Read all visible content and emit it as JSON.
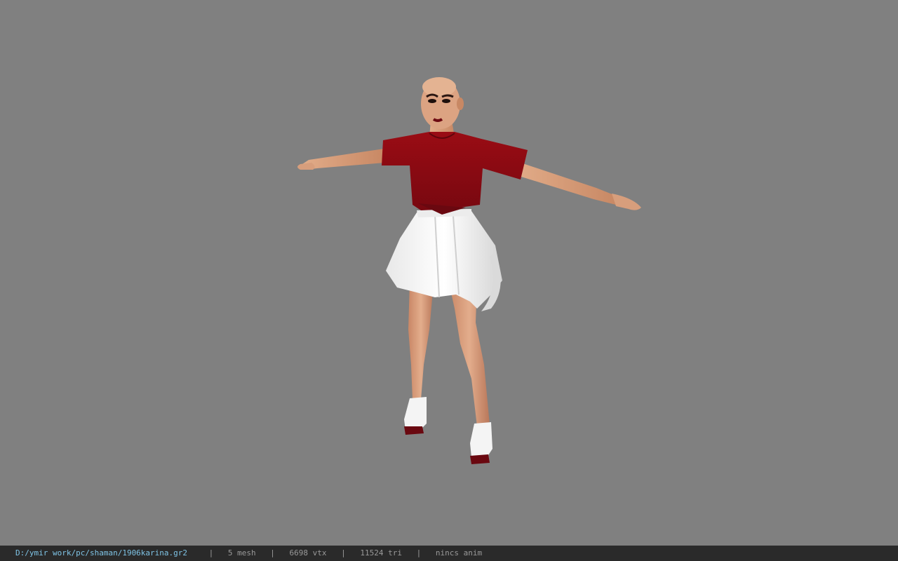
{
  "viewport": {
    "background": "#808080",
    "model": "character-tpose"
  },
  "statusbar": {
    "file_path": "D:/ymir work/pc/shaman/1906karina.gr2",
    "separator": "|",
    "mesh": "5 mesh",
    "vertices": "6698 vtx",
    "triangles": "11524 tri",
    "animation": "nincs anim"
  },
  "colors": {
    "shirt": "#8a0a10",
    "skirt": "#f2f2f2",
    "skin": "#d9a07a",
    "statusbar_bg": "#2a2a2a",
    "path_text": "#7fc4e6"
  }
}
